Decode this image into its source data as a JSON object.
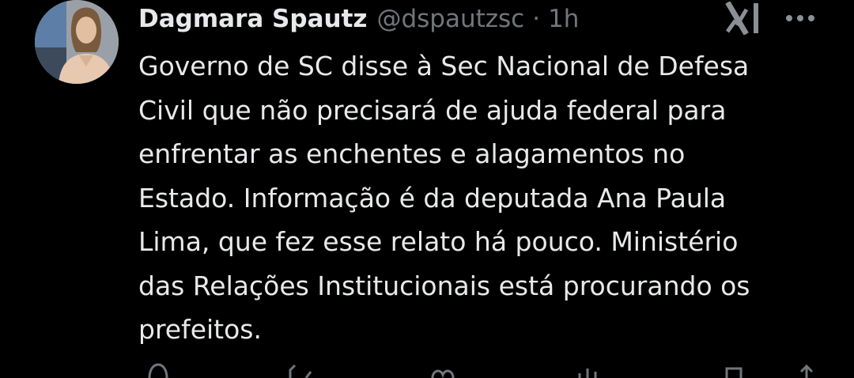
{
  "author": {
    "display_name": "Dagmara Spautz",
    "handle": "@dspautzsc",
    "separator": "·",
    "time": "1h",
    "avatar_icon": "profile-photo"
  },
  "tweet": {
    "text": "Governo de SC disse à Sec Nacional de Defesa\nCivil que não precisará de ajuda federal para\nenfrentar as enchentes e alagamentos no\nEstado. Informação é da deputada Ana Paula\nLima,  que fez esse relato há pouco. Ministério\ndas Relações Institucionais está procurando os\nprefeitos."
  },
  "icons": {
    "grok": "grok-icon",
    "more": "more-icon",
    "reply": "reply-icon",
    "retweet": "retweet-icon",
    "like": "like-icon",
    "views": "views-icon",
    "bookmark": "bookmark-icon",
    "share": "share-icon"
  },
  "colors": {
    "background": "#000000",
    "primary_text": "#e7e9ea",
    "secondary_text": "#71767b"
  }
}
